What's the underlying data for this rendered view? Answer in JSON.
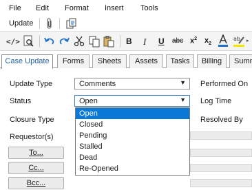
{
  "menu": [
    "File",
    "Edit",
    "Format",
    "Insert",
    "Tools"
  ],
  "toolbar": {
    "update_label": "Update"
  },
  "tabs": [
    "Case Update",
    "Forms",
    "Sheets",
    "Assets",
    "Tasks",
    "Billing",
    "Summ"
  ],
  "form": {
    "update_type_label": "Update Type",
    "update_type_value": "Comments",
    "performed_on_label": "Performed On",
    "status_label": "Status",
    "status_value": "Open",
    "log_time_label": "Log Time",
    "closure_type_label": "Closure Type",
    "resolved_by_label": "Resolved By",
    "requestors_label": "Requestor(s)",
    "to_button": "To...",
    "cc_button": "Cc...",
    "bcc_button": "Bcc..."
  },
  "status_options": [
    "Open",
    "Closed",
    "Pending",
    "Stalled",
    "Dead",
    "Re-Opened"
  ],
  "selected_status_index": 0,
  "colors": {
    "accent": "#0a78d7",
    "active_tab_text": "#1f5f9f",
    "highlight_yellow": "#f2e600"
  }
}
